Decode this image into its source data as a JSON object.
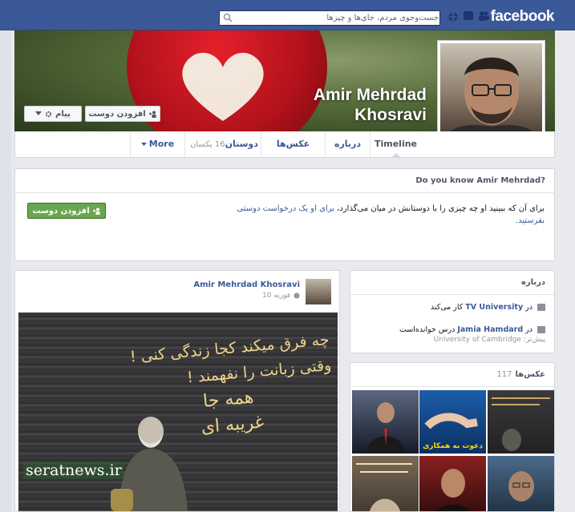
{
  "topbar": {
    "logo": "facebook",
    "search_placeholder": "جست‌وجوی مردم، جای‌ها و چیزها",
    "jewels": [
      "friend-requests-icon",
      "messages-icon",
      "notifications-icon"
    ]
  },
  "cover": {
    "name_line1": "Amir Mehrdad",
    "name_line2": "Khosravi",
    "add_friend_label": "افزودن دوست",
    "message_label": "پیام"
  },
  "tabs": {
    "timeline": "Timeline",
    "about": "درباره",
    "photos": "عکس‌ها",
    "friends": "دوستان",
    "friends_count": "16 یکسان",
    "more": "More"
  },
  "dyk": {
    "title": "Do you know Amir Mehrdad?",
    "text_part1": "برای آن که ببینید او چه چیزی را با دوستانش در میان می‌گذارد،",
    "text_link": "برای او یک درخواست دوستی بفرستید.",
    "button_label": "افزودن دوست"
  },
  "post": {
    "author": "Amir Mehrdad Khosravi",
    "date": "فوریه 10",
    "image_text": {
      "line1": "چه فرق میکند کجا زندگی کنی !",
      "line2": "وقتی زبانت را نفهمند !",
      "line3": "همه جا",
      "line4": "غریبه ای"
    },
    "watermark": "seratnews.ir"
  },
  "about": {
    "title": "درباره",
    "work_prefix": "در",
    "work_place": "TV University",
    "work_suffix": "کار می‌کند",
    "edu_prefix": "در",
    "edu_place": "Jamia Hamdard",
    "edu_suffix": "درس خوانده‌است",
    "edu_previous_label": "پیش‌تر:",
    "edu_previous": "University of Cambridge"
  },
  "photos": {
    "title": "عکس‌ها",
    "count": "117",
    "thumb_captions": [
      "",
      "دعوت به همکاری",
      "",
      "",
      "",
      ""
    ]
  },
  "colors": {
    "facebook_blue": "#3b5998",
    "link": "#3b5998",
    "green_button": "#69a74e"
  }
}
